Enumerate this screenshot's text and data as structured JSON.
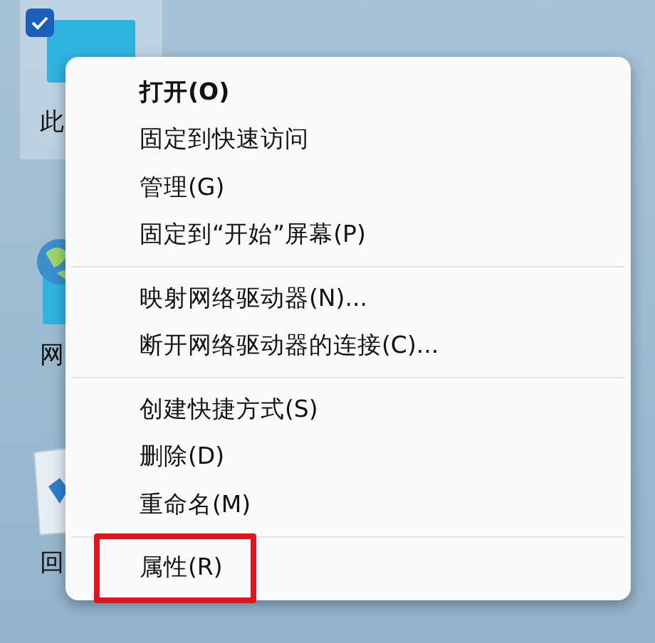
{
  "desktop_icons": [
    {
      "kind": "computer",
      "label": "此",
      "selected": true
    },
    {
      "kind": "network",
      "label": "网",
      "selected": false
    },
    {
      "kind": "recycle",
      "label": "回",
      "selected": false
    }
  ],
  "context_menu": {
    "items": [
      {
        "kind": "item",
        "label": "打开(O)",
        "default": true,
        "highlighted": false
      },
      {
        "kind": "item",
        "label": "固定到快速访问",
        "default": false,
        "highlighted": false
      },
      {
        "kind": "item",
        "label": "管理(G)",
        "default": false,
        "highlighted": false
      },
      {
        "kind": "item",
        "label": "固定到“开始”屏幕(P)",
        "default": false,
        "highlighted": false
      },
      {
        "kind": "separator"
      },
      {
        "kind": "item",
        "label": "映射网络驱动器(N)...",
        "default": false,
        "highlighted": false
      },
      {
        "kind": "item",
        "label": "断开网络驱动器的连接(C)...",
        "default": false,
        "highlighted": false
      },
      {
        "kind": "separator"
      },
      {
        "kind": "item",
        "label": "创建快捷方式(S)",
        "default": false,
        "highlighted": false
      },
      {
        "kind": "item",
        "label": "删除(D)",
        "default": false,
        "highlighted": false
      },
      {
        "kind": "item",
        "label": "重命名(M)",
        "default": false,
        "highlighted": false
      },
      {
        "kind": "separator"
      },
      {
        "kind": "item",
        "label": "属性(R)",
        "default": false,
        "highlighted": true
      }
    ]
  }
}
